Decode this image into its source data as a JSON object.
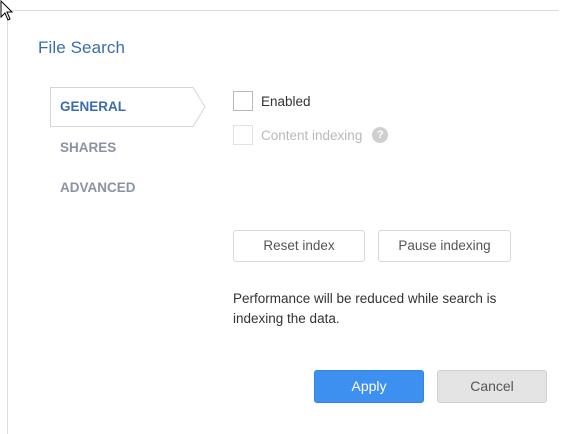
{
  "dialog": {
    "title": "File Search"
  },
  "nav": {
    "items": [
      {
        "label": "GENERAL",
        "active": true
      },
      {
        "label": "SHARES",
        "active": false
      },
      {
        "label": "ADVANCED",
        "active": false
      }
    ]
  },
  "general": {
    "enabled_label": "Enabled",
    "enabled_checked": false,
    "content_indexing_label": "Content indexing",
    "content_indexing_checked": false,
    "content_indexing_disabled": true,
    "help_glyph": "?",
    "reset_index_label": "Reset index",
    "pause_indexing_label": "Pause indexing",
    "note": "Performance will be reduced while search is indexing the data."
  },
  "footer": {
    "apply_label": "Apply",
    "cancel_label": "Cancel"
  },
  "colors": {
    "accent": "#3a6cb0",
    "apply_button": "#3d8ff0",
    "nav_inactive": "#8a93a3"
  },
  "icons": {
    "cursor": "mouse-pointer-icon",
    "help": "question-mark-icon"
  }
}
